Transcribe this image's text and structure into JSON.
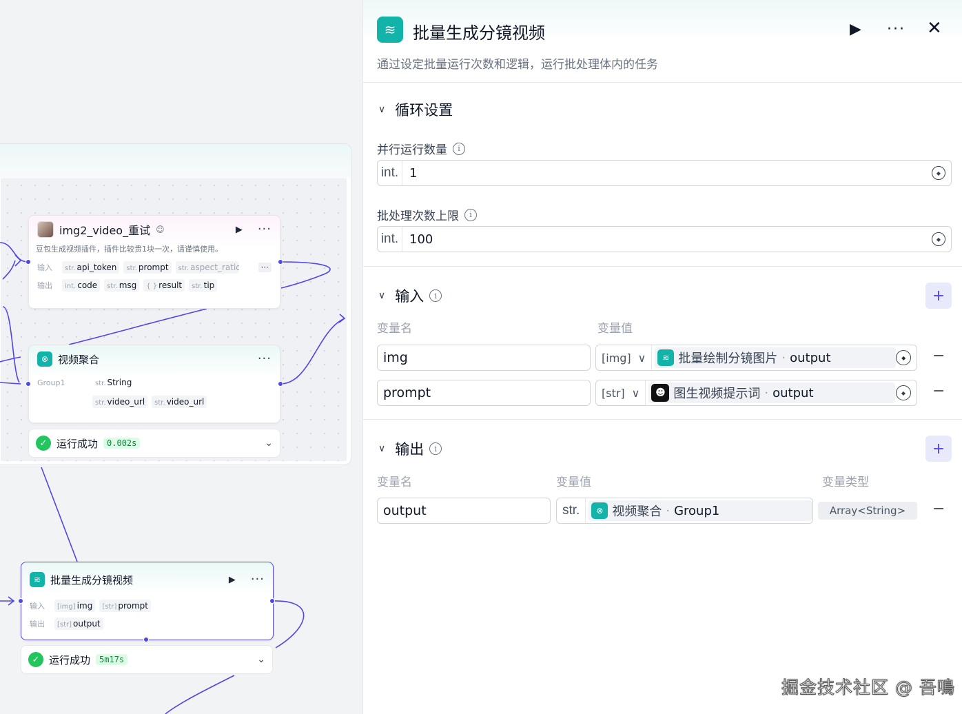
{
  "canvas": {
    "node1": {
      "title": "img2_video_重试",
      "desc": "豆包生成视频插件，插件比较贵1块一次，请谨慎使用。",
      "input_label": "输入",
      "output_label": "输出",
      "inputs": [
        {
          "type": "str.",
          "name": "api_token"
        },
        {
          "type": "str.",
          "name": "prompt"
        },
        {
          "type": "str.",
          "name": "aspect_ratio"
        }
      ],
      "outputs": [
        {
          "type": "int.",
          "name": "code"
        },
        {
          "type": "str.",
          "name": "msg"
        },
        {
          "type": "{ }",
          "name": "result"
        },
        {
          "type": "str.",
          "name": "tip"
        }
      ],
      "more": "···"
    },
    "node2": {
      "title": "视频聚合",
      "group_label": "Group1",
      "row1": [
        {
          "type": "str.",
          "name": "String"
        }
      ],
      "row2": [
        {
          "type": "str.",
          "name": "video_url"
        },
        {
          "type": "str.",
          "name": "video_url"
        }
      ]
    },
    "status1": {
      "text": "运行成功",
      "time": "0.002s"
    },
    "node3": {
      "title": "批量生成分镜视频",
      "input_label": "输入",
      "output_label": "输出",
      "inputs": [
        {
          "type": "[img]",
          "name": "img"
        },
        {
          "type": "[str]",
          "name": "prompt"
        }
      ],
      "outputs": [
        {
          "type": "[str]",
          "name": "output"
        }
      ]
    },
    "status2": {
      "text": "运行成功",
      "time": "5m17s"
    }
  },
  "panel": {
    "title": "批量生成分镜视频",
    "description": "通过设定批量运行次数和逻辑，运行批处理体内的任务",
    "loop": {
      "title": "循环设置",
      "parallel_label": "并行运行数量",
      "parallel_type": "int.",
      "parallel_value": "1",
      "limit_label": "批处理次数上限",
      "limit_type": "int.",
      "limit_value": "100"
    },
    "input": {
      "title": "输入",
      "col_name": "变量名",
      "col_value": "变量值",
      "rows": [
        {
          "name": "img",
          "type": "[img]",
          "source": "批量绘制分镜图片",
          "sep": "·",
          "field": "output"
        },
        {
          "name": "prompt",
          "type": "[str]",
          "source": "图生视频提示词",
          "sep": "·",
          "field": "output"
        }
      ]
    },
    "output": {
      "title": "输出",
      "col_name": "变量名",
      "col_value": "变量值",
      "col_type": "变量类型",
      "rows": [
        {
          "name": "output",
          "type": "str.",
          "source": "视频聚合",
          "sep": "·",
          "field": "Group1",
          "value_type": "Array<String>"
        }
      ]
    }
  },
  "watermark": "掘金技术社区 @ 吾鳴"
}
